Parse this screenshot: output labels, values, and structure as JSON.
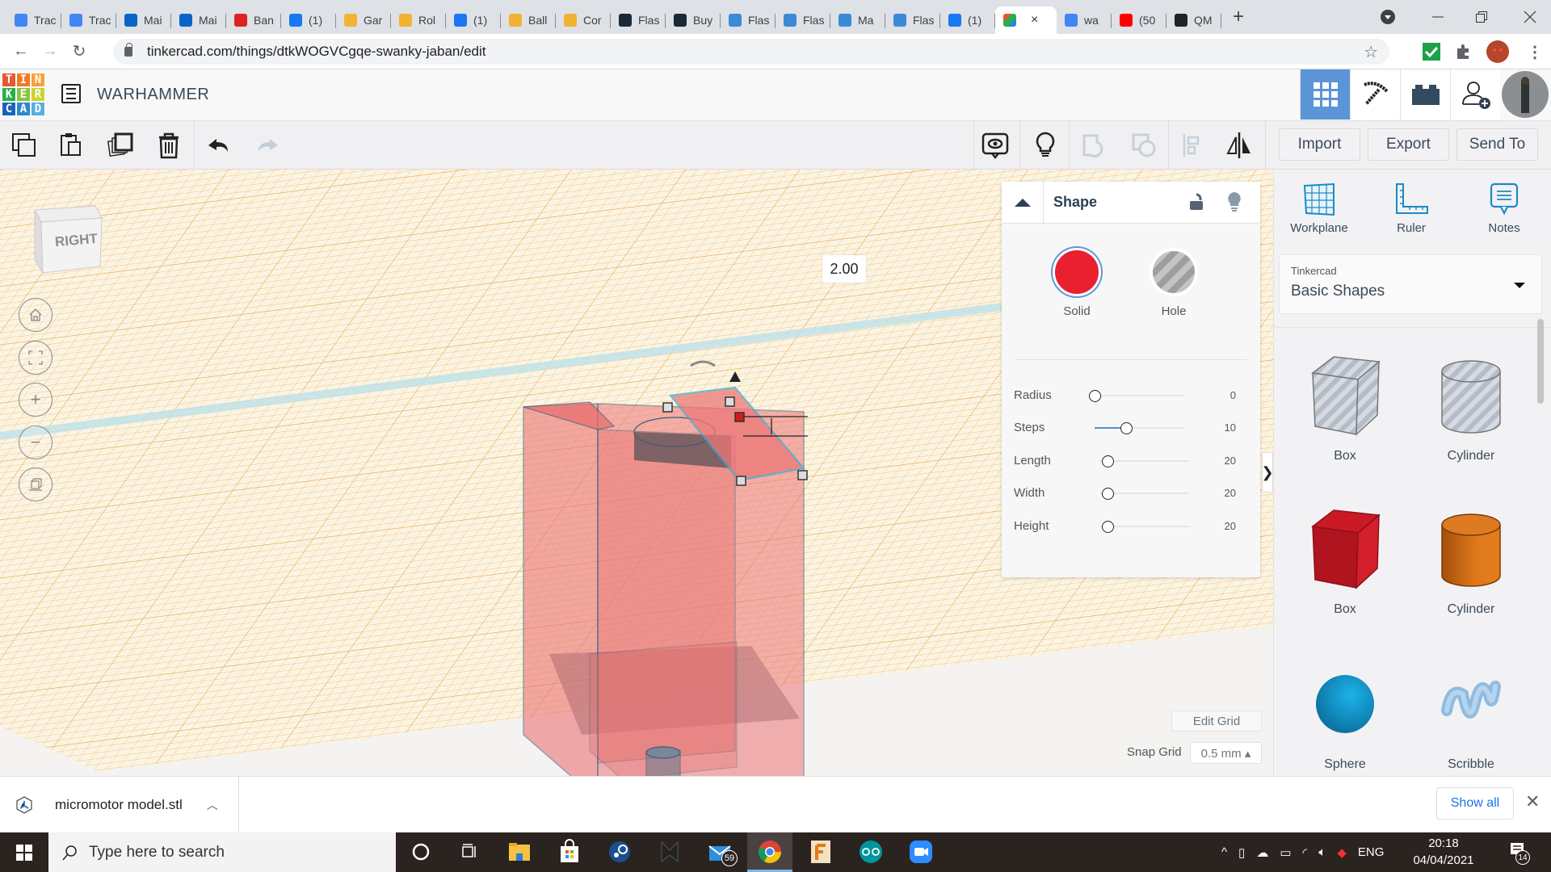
{
  "browser": {
    "tabs": [
      {
        "label": "Trac",
        "icon": "google-translate-icon",
        "color": "#4285f4"
      },
      {
        "label": "Trac",
        "icon": "google-translate-icon",
        "color": "#4285f4"
      },
      {
        "label": "Mai",
        "icon": "outlook-icon",
        "color": "#0a64c8"
      },
      {
        "label": "Mai",
        "icon": "outlook-icon",
        "color": "#0a64c8"
      },
      {
        "label": "Ban",
        "icon": "flower-icon",
        "color": "#d22"
      },
      {
        "label": "(1)",
        "icon": "facebook-icon",
        "color": "#1877f2"
      },
      {
        "label": "Gar",
        "icon": "emoji-icon",
        "color": "#f2b233"
      },
      {
        "label": "Rol",
        "icon": "emoji-icon",
        "color": "#f2b233"
      },
      {
        "label": "(1)",
        "icon": "facebook-icon",
        "color": "#1877f2"
      },
      {
        "label": "Ball",
        "icon": "emoji-icon",
        "color": "#f2b233"
      },
      {
        "label": "Cor",
        "icon": "emoji-icon",
        "color": "#f2b233"
      },
      {
        "label": "Flas",
        "icon": "flashforge-icon",
        "color": "#1b2838"
      },
      {
        "label": "Buy",
        "icon": "flashforge-icon",
        "color": "#1b2838"
      },
      {
        "label": "Flas",
        "icon": "flashforge-icon",
        "color": "#3b8ad8"
      },
      {
        "label": "Flas",
        "icon": "flashforge-icon",
        "color": "#3b8ad8"
      },
      {
        "label": "Ma",
        "icon": "flashforge-icon",
        "color": "#3b8ad8"
      },
      {
        "label": "Flas",
        "icon": "flashforge-icon",
        "color": "#3b8ad8"
      },
      {
        "label": "(1)",
        "icon": "facebook-icon",
        "color": "#1877f2"
      }
    ],
    "active_tab": {
      "label": "",
      "icon": "tinkercad-icon",
      "close": "×"
    },
    "tabs_after": [
      {
        "label": "wa",
        "icon": "google-icon",
        "color": "#4285f4"
      },
      {
        "label": "(50",
        "icon": "youtube-icon",
        "color": "#f00"
      },
      {
        "label": "QM",
        "icon": "amazon-icon",
        "color": "#222"
      }
    ],
    "new_tab": "+",
    "url": "tinkercad.com/things/dtkWOGVCgqe-swanky-jaban/edit"
  },
  "app": {
    "logo_letters": [
      "T",
      "I",
      "N",
      "K",
      "E",
      "R",
      "C",
      "A",
      "D"
    ],
    "logo_colors": [
      "#e8562c",
      "#ef7a2a",
      "#f5a13a",
      "#27b04a",
      "#8cc43f",
      "#c9d52f",
      "#1c63b7",
      "#2c87d0",
      "#5aaddf"
    ],
    "design_title": "WARHAMMER"
  },
  "toolbar": {
    "import": "Import",
    "export": "Export",
    "send_to": "Send To"
  },
  "viewport": {
    "view_cube_face": "RIGHT",
    "dimension_value": "2.00"
  },
  "inspector": {
    "title": "Shape",
    "solid_label": "Solid",
    "hole_label": "Hole",
    "solid_color": "#e8202f",
    "properties": [
      {
        "label": "Radius",
        "value": "0",
        "fraction": 0.0
      },
      {
        "label": "Steps",
        "value": "10",
        "fraction": 0.35
      },
      {
        "label": "Length",
        "value": "20",
        "fraction": 0.08
      },
      {
        "label": "Width",
        "value": "20",
        "fraction": 0.08
      },
      {
        "label": "Height",
        "value": "20",
        "fraction": 0.08
      }
    ]
  },
  "grid": {
    "edit_grid": "Edit Grid",
    "snap_label": "Snap Grid",
    "snap_value": "0.5 mm ▴"
  },
  "sidebar": {
    "tools": [
      {
        "label": "Workplane"
      },
      {
        "label": "Ruler"
      },
      {
        "label": "Notes"
      }
    ],
    "library_source": "Tinkercad",
    "library_name": "Basic Shapes",
    "shapes": [
      {
        "label": "Box"
      },
      {
        "label": "Cylinder"
      },
      {
        "label": "Box"
      },
      {
        "label": "Cylinder"
      },
      {
        "label": "Sphere"
      },
      {
        "label": "Scribble"
      }
    ]
  },
  "downloads": {
    "file_name": "micromotor model.stl",
    "show_all": "Show all",
    "close": "✕"
  },
  "taskbar": {
    "search_placeholder": "Type here to search",
    "mail_badge": "59",
    "language": "ENG",
    "time": "20:18",
    "date": "04/04/2021",
    "notification_count": "14"
  }
}
